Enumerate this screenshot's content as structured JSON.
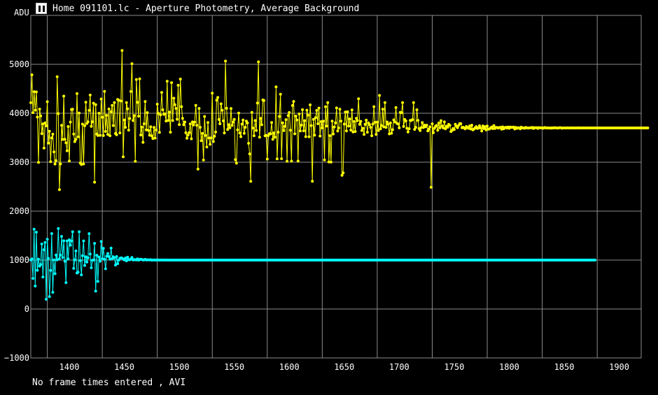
{
  "window": {
    "title": "Home 091101.lc - Aperture Photometry, Average Background",
    "icon": "app-logo-icon"
  },
  "status": {
    "footer": "No frame times entered , AVI"
  },
  "colors": {
    "background": "#000000",
    "grid": "#8c8c8c",
    "series_1": "#ffff00",
    "series_2": "#00ffff"
  },
  "chart_data": {
    "type": "line",
    "ylabel": "ADU",
    "xlabel": "",
    "xlim": [
      1365,
      1920
    ],
    "ylim": [
      -1000,
      6000
    ],
    "xticks": [
      1400,
      1450,
      1500,
      1550,
      1600,
      1650,
      1700,
      1750,
      1800,
      1850,
      1900
    ],
    "xtick_labels": [
      "1400",
      "1450",
      "1500",
      "1550",
      "1600",
      "1650",
      "1700",
      "1750",
      "1800",
      "1850",
      "1900"
    ],
    "yticks": [
      -1000,
      0,
      1000,
      2000,
      3000,
      4000,
      5000
    ],
    "ytick_labels": [
      "−1000",
      "0",
      "1000",
      "2000",
      "3000",
      "4000",
      "5000"
    ],
    "x_gridlines": [
      1380,
      1430,
      1480,
      1530,
      1580,
      1630,
      1680,
      1730,
      1780,
      1830,
      1880
    ],
    "grid": true,
    "markers": true,
    "series": [
      {
        "color": "#ffff00",
        "x_start": 1365,
        "x_step": 1,
        "values": [
          4215,
          4786,
          4013,
          4441,
          4063,
          4436,
          3921,
          2997,
          4085,
          3947,
          3584,
          3782,
          3288,
          3803,
          3743,
          4236,
          3389,
          3631,
          3011,
          3497,
          3573,
          3211,
          2963,
          3033,
          4745,
          3993,
          2439,
          2965,
          3755,
          3464,
          4350,
          3469,
          3395,
          3234,
          3729,
          3025,
          3820,
          4077,
          4083,
          3576,
          3421,
          3468,
          4401,
          3519,
          4004,
          2982,
          2954,
          3779,
          2965,
          3744,
          4224,
          3791,
          3824,
          4058,
          4372,
          3733,
          3824,
          4206,
          2591,
          4176,
          3574,
          3546,
          4000,
          3548,
          4292,
          3917,
          3544,
          4447,
          3628,
          3957,
          3568,
          4087,
          3541,
          4031,
          4160,
          3749,
          4219,
          3586,
          3561,
          4282,
          4268,
          3599,
          4250,
          5281,
          3110,
          3863,
          3713,
          4218,
          4091,
          3656,
          3893,
          4444,
          5013,
          3851,
          3951,
          3017,
          4688,
          4223,
          3938,
          4703,
          3556,
          3718,
          3405,
          3786,
          4240,
          3662,
          4013,
          3650,
          3552,
          3723,
          3537,
          3484,
          3712,
          3493,
          3658,
          4185,
          3998,
          3608,
          3967,
          4425,
          4071,
          3978,
          3987,
          3842,
          4655,
          3854,
          4023,
          3613,
          4624,
          3852,
          4307,
          4175,
          4098,
          3877,
          4571,
          3768,
          4698,
          4134,
          3897,
          3765,
          3821,
          3602,
          3489,
          3556,
          3605,
          3781,
          3478,
          3823,
          3760,
          3817,
          4160,
          3755,
          2858,
          4099,
          3713,
          3440,
          3588,
          3045,
          3934,
          3546,
          3312,
          3811,
          3495,
          3364,
          3497,
          4412,
          3421,
          3530,
          3616,
          4268,
          4323,
          3873,
          3786,
          4193,
          4060,
          3844,
          3598,
          5065,
          4101,
          3667,
          3768,
          3704,
          4096,
          3751,
          3820,
          3875,
          3052,
          2980,
          3662,
          4003,
          3596,
          3521,
          3779,
          3863,
          3588,
          3713,
          3840,
          3802,
          3386,
          3170,
          2609,
          4018,
          3699,
          3542,
          3852,
          3649,
          4208,
          5050,
          3510,
          3894,
          3766,
          4272,
          4260,
          3540,
          3549,
          3064,
          3544,
          3584,
          3579,
          3812,
          3467,
          3599,
          3512,
          4539,
          3067,
          3613,
          3934,
          4389,
          3071,
          3806,
          3646,
          3734,
          3870,
          3020,
          3953,
          4015,
          3653,
          3023,
          4158,
          4241,
          3580,
          3941,
          3863,
          3024,
          3986,
          3640,
          3757,
          4073,
          3642,
          3849,
          3522,
          4063,
          3962,
          3520,
          4171,
          3749,
          2612,
          3875,
          3551,
          3911,
          4059,
          3786,
          4106,
          3534,
          3828,
          3700,
          3838,
          3046,
          4134,
          3737,
          4217,
          3006,
          3543,
          3002,
          3839,
          3577,
          3720,
          3805,
          4108,
          3637,
          3700,
          4082,
          3840,
          2733,
          2782,
          3778,
          4024,
          3638,
          4030,
          3737,
          3885,
          3655,
          4067,
          3617,
          3831,
          3627,
          3897,
          3848,
          4297,
          3774,
          3834,
          3649,
          3693,
          3569,
          3773,
          3859,
          3613,
          3805,
          3767,
          3713,
          3542,
          3778,
          4135,
          3814,
          3567,
          3820,
          3646,
          4364,
          3683,
          3750,
          4084,
          3721,
          4217,
          3712,
          3821,
          3775,
          3578,
          3803,
          3591,
          3664,
          3865,
          3823,
          4116,
          3791,
          3782,
          3702,
          4017,
          4012,
          4219,
          3730,
          3873,
          3843,
          3693,
          3617,
          3684,
          3854,
          3854,
          3870,
          4217,
          3670,
          3713,
          4071,
          3854,
          3687,
          3645,
          3707,
          3808,
          3709,
          3757,
          3726,
          3756,
          3640,
          3679,
          3723,
          2487,
          3784,
          3601,
          3693,
          3731,
          3752,
          3651,
          3802,
          3701,
          3848,
          3739,
          3700,
          3826,
          3681,
          3736,
          3714,
          3773,
          3753,
          3627,
          3650,
          3690,
          3669,
          3775,
          3732,
          3706,
          3751,
          3788,
          3787,
          3703,
          3714,
          3700,
          3682,
          3729,
          3707,
          3693,
          3742,
          3678,
          3756,
          3661,
          3679,
          3701,
          3727,
          3689,
          3698,
          3744,
          3700,
          3637,
          3742,
          3687,
          3724,
          3662,
          3738,
          3674,
          3679,
          3700,
          3719,
          3686,
          3748,
          3690,
          3710,
          3708,
          3696,
          3708,
          3713,
          3674,
          3721,
          3682,
          3706,
          3714,
          3697,
          3717,
          3693,
          3717,
          3710,
          3710,
          3719,
          3679,
          3711,
          3692,
          3704,
          3702,
          3681,
          3715,
          3700,
          3700,
          3693,
          3712,
          3702,
          3699,
          3700,
          3702,
          3704,
          3712,
          3688,
          3705,
          3703,
          3706,
          3692,
          3707,
          3702,
          3702,
          3700,
          3695,
          3708,
          3704,
          3699,
          3701,
          3699,
          3700,
          3695,
          3704,
          3699,
          3706,
          3701,
          3701,
          3697,
          3700,
          3705,
          3704,
          3695,
          3700,
          3701,
          3699,
          3700,
          3701,
          3699,
          3700,
          3702,
          3700,
          3701,
          3699,
          3700,
          3700,
          3701,
          3700,
          3701,
          3699,
          3700,
          3700,
          3701,
          3700,
          3700,
          3700,
          3700,
          3700,
          3700,
          3700,
          3700,
          3700,
          3700,
          3700,
          3700,
          3700,
          3700,
          3700,
          3700,
          3700,
          3700,
          3700,
          3700,
          3700,
          3700,
          3700,
          3700,
          3700,
          3700,
          3700,
          3700,
          3700,
          3700,
          3700,
          3700,
          3700,
          3700,
          3700,
          3700,
          3700,
          3700,
          3700,
          3700,
          3700,
          3700,
          3700,
          3700,
          3700,
          3700,
          3700,
          3700,
          3700,
          3700,
          3700,
          3700,
          3700,
          3700,
          3700,
          3700,
          3700,
          3700
        ]
      },
      {
        "color": "#00ffff",
        "x_start": 1365,
        "x_step": 1,
        "values": [
          1003,
          1023,
          625,
          1630,
          470,
          1570,
          791,
          1018,
          876,
          912,
          1328,
          654,
          1210,
          1361,
          199,
          1426,
          1034,
          253,
          788,
          1541,
          342,
          1003,
          722,
          1104,
          1005,
          1644,
          1023,
          1101,
          1484,
          1052,
          1394,
          975,
          540,
          1391,
          1025,
          1414,
          1303,
          1390,
          1578,
          830,
          1005,
          1187,
          736,
          752,
          1579,
          990,
          699,
          1090,
          1391,
          890,
          1069,
          959,
          1046,
          1540,
          1123,
          843,
          994,
          1001,
          1342,
          366,
          1098,
          564,
          1063,
          977,
          1380,
          1029,
          1239,
          1015,
          823,
          1078,
          1134,
          1071,
          1018,
          1245,
          1030,
          1068,
          1046,
          898,
          1071,
          927,
          1000,
          1037,
          1045,
          1038,
          1020,
          1003,
          1041,
          984,
          1059,
          1007,
          1005,
          1024,
          1054,
          1001,
          1011,
          1006,
          1003,
          1025,
          999,
          1010,
          1017,
          1011,
          1001,
          1005,
          1014,
          1002,
          1006,
          1003,
          1004,
          1007,
          998,
          1002,
          1001,
          1002,
          1000,
          1004,
          1002,
          999,
          1001,
          1000,
          1001,
          1000,
          1001,
          1000,
          1000,
          1000,
          1000,
          1000,
          1000,
          1000,
          1000,
          1000,
          1000,
          1000,
          1000,
          1000,
          1000,
          1000,
          1000,
          1000,
          1000,
          1000,
          1000,
          1000,
          1000,
          1000,
          1000,
          1000,
          1000,
          1000,
          1000,
          1000,
          1000,
          1000,
          1000,
          1000,
          1000,
          1000,
          1000,
          1000,
          1000,
          1000,
          1000,
          1000,
          1000,
          1000,
          1000,
          1000,
          1000,
          1000,
          1000,
          1000,
          1000,
          1000,
          1000,
          1000,
          1000,
          1000,
          1000,
          1000,
          1000,
          1000,
          1000,
          1000,
          1000,
          1000,
          1000,
          1000,
          1000,
          1000,
          1000,
          1000,
          1000,
          1000,
          1000,
          1000,
          1000,
          1000,
          1000,
          1000,
          1000,
          1000,
          1000,
          1000,
          1000,
          1000,
          1000,
          1000,
          1000,
          1000,
          1000,
          1000,
          1000,
          1000,
          1000,
          1000,
          1000,
          1000,
          1000,
          1000,
          1000,
          1000,
          1000,
          1000,
          1000,
          1000,
          1000,
          1000,
          1000,
          1000,
          1000,
          1000,
          1000,
          1000,
          1000,
          1000,
          1000,
          1000,
          1000,
          1000,
          1000,
          1000,
          1000,
          1000,
          1000,
          1000,
          1000,
          1000,
          1000,
          1000,
          1000,
          1000,
          1000,
          1000,
          1000,
          1000,
          1000,
          1000,
          1000,
          1000,
          1000,
          1000,
          1000,
          1000,
          1000,
          1000,
          1000,
          1000,
          1000,
          1000,
          1000,
          1000,
          1000,
          1000,
          1000,
          1000,
          1000,
          1000,
          1000,
          1000,
          1000,
          1000,
          1000,
          1000,
          1000,
          1000,
          1000,
          1000,
          1000,
          1000,
          1000,
          1000,
          1000,
          1000,
          1000,
          1000,
          1000,
          1000,
          1000,
          1000,
          1000,
          1000,
          1000,
          1000,
          1000,
          1000,
          1000,
          1000,
          1000,
          1000,
          1000,
          1000,
          1000,
          1000,
          1000,
          1000,
          1000,
          1000,
          1000,
          1000,
          1000,
          1000,
          1000,
          1000,
          1000,
          1000,
          1000,
          1000,
          1000,
          1000,
          1000,
          1000,
          1000,
          1000,
          1000,
          1000,
          1000,
          1000,
          1000,
          1000,
          1000,
          1000,
          1000,
          1000,
          1000,
          1000,
          1000,
          1000,
          1000,
          1000,
          1000,
          1000,
          1000,
          1000,
          1000,
          1000,
          1000,
          1000,
          1000,
          1000,
          1000,
          1000,
          1000,
          1000,
          1000,
          1000,
          1000,
          1000,
          1000,
          1000,
          1000,
          1000,
          1000,
          1000,
          1000,
          1000,
          1000,
          1000,
          1000,
          1000,
          1000,
          1000,
          1000,
          1000,
          1000,
          1000,
          1000,
          1000,
          1000,
          1000,
          1000,
          1000,
          1000,
          1000,
          1000,
          1000,
          1000,
          1000,
          1000,
          1000,
          1000,
          1000,
          1000,
          1000,
          1000,
          1000,
          1000,
          1000,
          1000,
          1000,
          1000,
          1000,
          1000,
          1000,
          1000,
          1000,
          1000,
          1000,
          1000,
          1000,
          1000,
          1000,
          1000,
          1000,
          1000,
          1000,
          1000,
          1000,
          1000,
          1000,
          1000,
          1000,
          1000,
          1000,
          1000,
          1000,
          1000,
          1000,
          1000,
          1000,
          1000,
          1000,
          1000,
          1000,
          1000,
          1000,
          1000,
          1000,
          1000,
          1000,
          1000,
          1000,
          1000,
          1000,
          1000,
          1000,
          1000,
          1000,
          1000,
          1000,
          1000,
          1000,
          1000,
          1000,
          1000,
          1000,
          1000,
          1000,
          1000,
          1000,
          1000,
          1000,
          1000,
          1000,
          1000,
          1000,
          1000,
          1000,
          1000,
          1000,
          1000,
          1000,
          1000,
          1000,
          1000,
          1000,
          1000,
          1000,
          1000,
          1000,
          1000,
          1000,
          1000,
          1000,
          1000,
          1000,
          1000,
          1000,
          1000,
          1000,
          1000,
          1000,
          1000,
          1000,
          1000,
          1000,
          1000,
          1000,
          1000,
          1000,
          1000,
          1000,
          1000,
          1000
        ]
      }
    ]
  }
}
